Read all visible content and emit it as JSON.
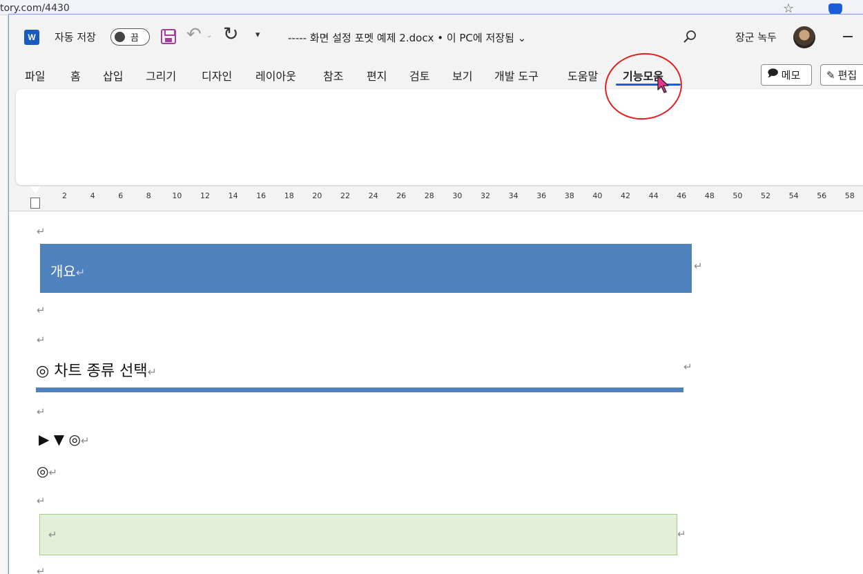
{
  "browser": {
    "url_fragment": "tory.com/4430",
    "star_icon": "star-icon",
    "shield_icon": "shield-icon"
  },
  "titlebar": {
    "app_letter": "W",
    "autosave_label": "자동 저장",
    "autosave_state": "끔",
    "document_title": "----- 화면 설정 포멧 예제 2.docx • 이 PC에 저장됨 ⌄",
    "user_name": "장군 녹두",
    "qat_more": "▾"
  },
  "tabs": [
    {
      "label": "파일",
      "active": false
    },
    {
      "label": "홈",
      "active": false
    },
    {
      "label": "삽입",
      "active": false
    },
    {
      "label": "그리기",
      "active": false
    },
    {
      "label": "디자인",
      "active": false
    },
    {
      "label": "레이아웃",
      "active": false
    },
    {
      "label": "참조",
      "active": false
    },
    {
      "label": "편지",
      "active": false
    },
    {
      "label": "검토",
      "active": false
    },
    {
      "label": "보기",
      "active": false
    },
    {
      "label": "개발 도구",
      "active": false
    },
    {
      "label": "도움말",
      "active": false
    },
    {
      "label": "기능모음",
      "active": true
    }
  ],
  "ribbon_buttons": {
    "memo_label": "메모",
    "edit_label": "편집"
  },
  "ruler": {
    "numbers": [
      "2",
      "4",
      "6",
      "8",
      "10",
      "12",
      "14",
      "16",
      "18",
      "20",
      "22",
      "24",
      "26",
      "28",
      "30",
      "32",
      "34",
      "36",
      "38",
      "40",
      "42",
      "44",
      "46",
      "48",
      "50",
      "52",
      "54",
      "56",
      "58"
    ]
  },
  "document": {
    "pilcrow": "↵",
    "heading1": "개요",
    "heading2": "◎ 차트 종류 선택",
    "symbols_line1": "▶ ▼  ◎",
    "symbols_line2": "◎"
  },
  "colors": {
    "heading_fill": "#4f81bd",
    "box_fill": "#e3efd6",
    "accent": "#1a5fd8",
    "callout": "#e02020"
  }
}
